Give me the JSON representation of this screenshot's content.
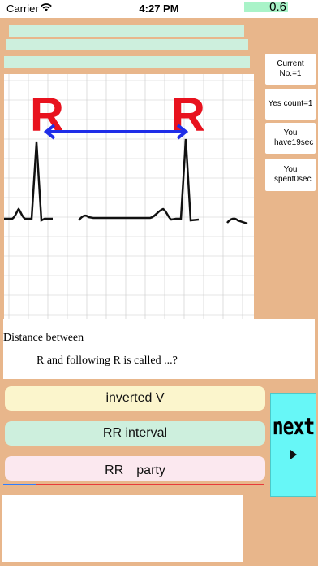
{
  "status_bar": {
    "carrier": "Carrier",
    "time": "4:27 PM",
    "battery_text": "0.6"
  },
  "info": {
    "current_no": "Current No.=1",
    "yes_count": "Yes count=1",
    "time_left": "You have19sec",
    "time_spent": "You spent0sec"
  },
  "ecg_image": {
    "r_label": "R"
  },
  "question": {
    "line1": "Distance between",
    "line2": "R and following R is called ...?"
  },
  "answers": [
    {
      "label": "inverted V",
      "color": "#FBF5CC"
    },
    {
      "label": "RR interval",
      "color": "#CDEFDD"
    },
    {
      "label": "RR　party",
      "color": "#FBE8EF"
    }
  ],
  "next_button": {
    "label": "next",
    "color": "#67F7F7"
  },
  "colors": {
    "background": "#E8B68B",
    "mint": "#CDEFDD",
    "progress_done": "#2F7CFF",
    "progress_remaining": "#E83A3A"
  },
  "icons": [
    "wifi-icon",
    "play-arrow-icon",
    "double-arrow-icon"
  ]
}
